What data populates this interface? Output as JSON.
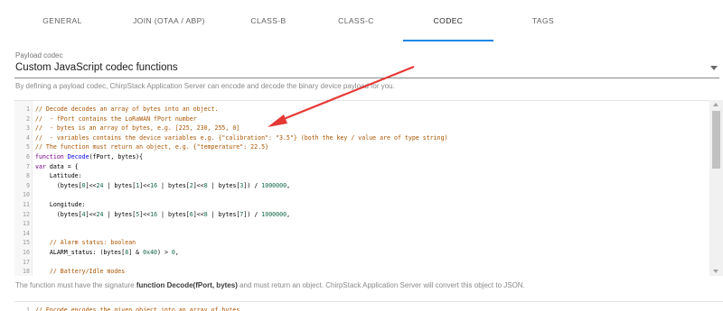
{
  "tabs": [
    {
      "label": "GENERAL"
    },
    {
      "label": "JOIN (OTAA / ABP)"
    },
    {
      "label": "CLASS-B"
    },
    {
      "label": "CLASS-C"
    },
    {
      "label": "CODEC",
      "active": true
    },
    {
      "label": "TAGS"
    }
  ],
  "codec_select": {
    "label": "Payload codec",
    "value": "Custom JavaScript codec functions"
  },
  "help_text_codec": "By defining a payload codec, ChirpStack Application Server can encode and decode the binary device payload for you.",
  "decode_editor": {
    "lines": [
      {
        "n": "1",
        "text": "// Decode decodes an array of bytes into an object."
      },
      {
        "n": "2",
        "text": "//  - fPort contains the LoRaWAN fPort number"
      },
      {
        "n": "3",
        "text": "//  - bytes is an array of bytes, e.g. [225, 230, 255, 0]"
      },
      {
        "n": "4",
        "text": "//  - variables contains the device variables e.g. {\"calibration\": \"3.5\"} (both the key / value are of type string)"
      },
      {
        "n": "5",
        "text": "// The function must return an object, e.g. {\"temperature\": 22.5}"
      },
      {
        "n": "6",
        "text": "function Decode(fPort, bytes){"
      },
      {
        "n": "7",
        "text": "var data = {"
      },
      {
        "n": "8",
        "text": "    Latitude:"
      },
      {
        "n": "9",
        "text": "      (bytes[0]<<24 | bytes[1]<<16 | bytes[2]<<8 | bytes[3]) / 1000000,"
      },
      {
        "n": "10",
        "text": ""
      },
      {
        "n": "11",
        "text": "    Longitude:"
      },
      {
        "n": "12",
        "text": "      (bytes[4]<<24 | bytes[5]<<16 | bytes[6]<<8 | bytes[7]) / 1000000,"
      },
      {
        "n": "13",
        "text": ""
      },
      {
        "n": "14",
        "text": ""
      },
      {
        "n": "15",
        "text": "    // Alarm status: boolean"
      },
      {
        "n": "16",
        "text": "    ALARM_status: (bytes[8] & 0x40) > 0,"
      },
      {
        "n": "17",
        "text": ""
      },
      {
        "n": "18",
        "text": "    // Battery/Idle modes"
      }
    ]
  },
  "help_text_decode": {
    "before": "The function must have the signature ",
    "signature": "function Decode(fPort, bytes)",
    "after": " and must return an object. ChirpStack Application Server will convert this object to JSON."
  },
  "encode_editor": {
    "lines": [
      {
        "n": "1",
        "text": "// Encode encodes the given object into an array of bytes."
      }
    ]
  },
  "colors": {
    "accent": "#1e88e5",
    "annotation_arrow": "#e53935"
  }
}
